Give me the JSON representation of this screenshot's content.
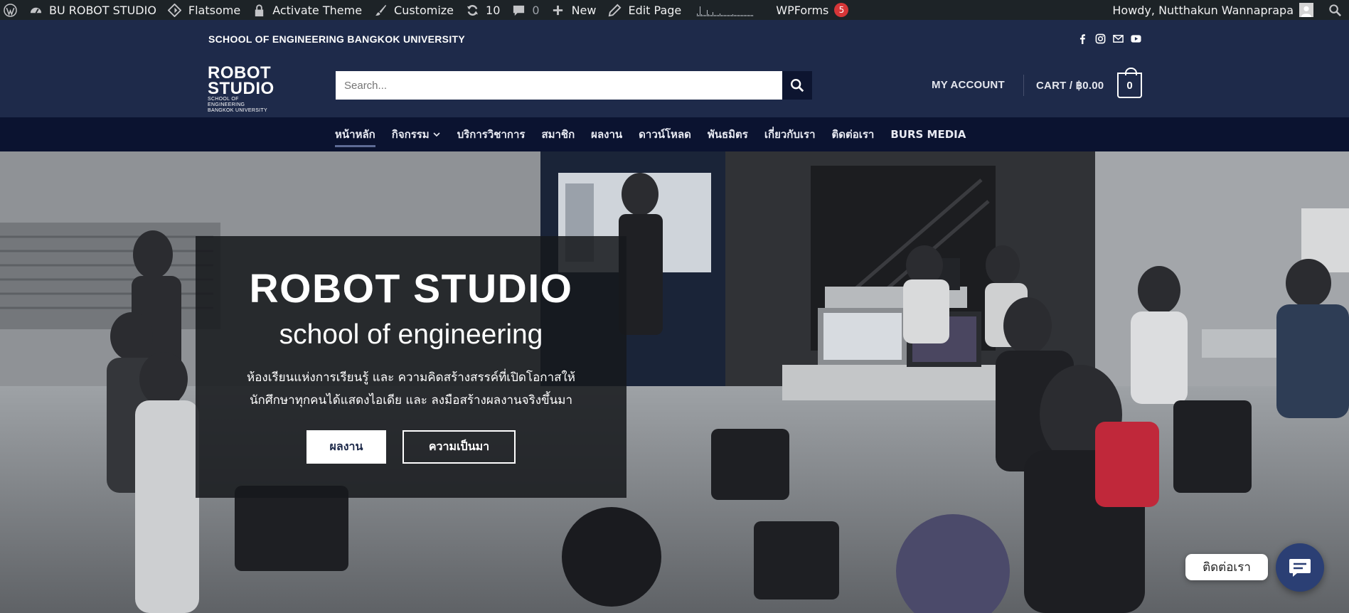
{
  "adminbar": {
    "site_name": "BU ROBOT STUDIO",
    "theme": "Flatsome",
    "activate": "Activate Theme",
    "customize": "Customize",
    "updates_count": "10",
    "comments_count": "0",
    "new_label": "New",
    "edit_page": "Edit Page",
    "wpforms": "WPForms",
    "wpforms_badge": "5",
    "howdy": "Howdy, Nutthakun Wannaprapa"
  },
  "topbar": {
    "school": "SCHOOL OF ENGINEERING BANGKOK UNIVERSITY"
  },
  "header": {
    "logo_line1": "ROBOT",
    "logo_line2": "STUDIO",
    "logo_line3": "SCHOOL OF ENGINEERING",
    "logo_line4": "BANGKOK UNIVERSITY",
    "search_placeholder": "Search...",
    "my_account": "MY ACCOUNT",
    "cart_label": "CART / ฿0.00",
    "cart_count": "0"
  },
  "nav": {
    "items": [
      {
        "label": "หน้าหลัก"
      },
      {
        "label": "กิจกรรม"
      },
      {
        "label": "บริการวิชาการ"
      },
      {
        "label": "สมาชิก"
      },
      {
        "label": "ผลงาน"
      },
      {
        "label": "ดาวน์โหลด"
      },
      {
        "label": "พันธมิตร"
      },
      {
        "label": "เกี่ยวกับเรา"
      },
      {
        "label": "ติดต่อเรา"
      },
      {
        "label": "BURS MEDIA"
      }
    ]
  },
  "hero": {
    "title": "ROBOT STUDIO",
    "subtitle": "school of engineering",
    "desc_line1": "ห้องเรียนแห่งการเรียนรู้ และ ความคิดสร้างสรรค์ที่เปิดโอกาสให้",
    "desc_line2": "นักศึกษาทุกคนได้แสดงไอเดีย และ ลงมือสร้างผลงานจริงขึ้นมา",
    "button_primary": "ผลงาน",
    "button_secondary": "ความเป็นมา"
  },
  "chat": {
    "label": "ติดต่อเรา"
  },
  "colors": {
    "header_bg": "#1e2a4a",
    "nav_bg": "#0b1330",
    "adminbar_bg": "#1d2327",
    "chat_btn": "#2b3f74"
  }
}
